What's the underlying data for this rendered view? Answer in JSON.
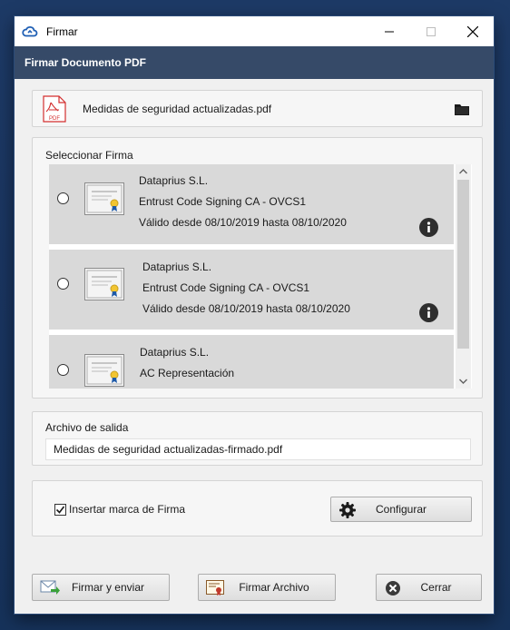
{
  "window": {
    "title": "Firmar",
    "header": "Firmar Documento PDF"
  },
  "file": {
    "name": "Medidas de seguridad actualizadas.pdf",
    "pdf_icon_label": "PDF"
  },
  "signatures": {
    "label": "Seleccionar Firma",
    "items": [
      {
        "holder": "Dataprius S.L.",
        "issuer": "Entrust Code Signing CA - OVCS1",
        "validity": "Válido desde 08/10/2019 hasta 08/10/2020"
      },
      {
        "holder": "Dataprius S.L.",
        "issuer": "Entrust Code Signing CA - OVCS1",
        "validity": "Válido desde 08/10/2019 hasta 08/10/2020"
      },
      {
        "holder": "Dataprius S.L.",
        "issuer": "AC Representación"
      }
    ]
  },
  "output": {
    "label": "Archivo de salida",
    "value": "Medidas de seguridad actualizadas-firmado.pdf"
  },
  "options": {
    "watermark_label": "Insertar marca de Firma",
    "watermark_checked": true,
    "configure_label": "Configurar"
  },
  "actions": {
    "sign_send": "Firmar y enviar",
    "sign_file": "Firmar Archivo",
    "close": "Cerrar"
  },
  "colors": {
    "header_band": "#364a68",
    "desktop": "#1d3a66",
    "list_item_bg": "#d9d9d9",
    "pdf_red": "#d32f2f"
  }
}
